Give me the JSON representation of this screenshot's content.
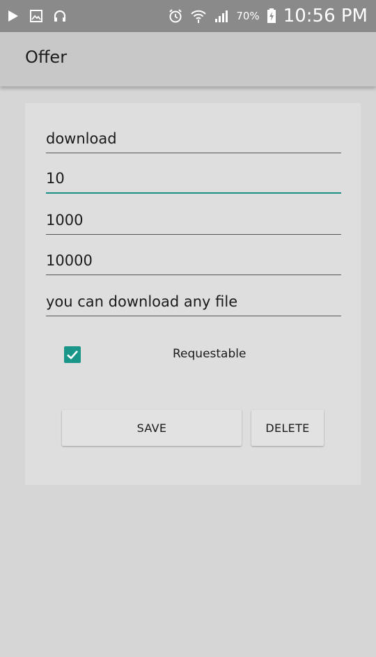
{
  "status_bar": {
    "battery_percent": "70%",
    "time": "10:56 PM",
    "left_icons": [
      "play-icon",
      "image-icon",
      "headset-icon"
    ],
    "right_icons": [
      "alarm-icon",
      "wifi-icon",
      "signal-icon",
      "battery-charging-icon"
    ]
  },
  "app_bar": {
    "title": "Offer"
  },
  "form": {
    "fields": [
      {
        "value": "download",
        "focused": false
      },
      {
        "value": "10",
        "focused": true
      },
      {
        "value": "1000",
        "focused": false
      },
      {
        "value": "10000",
        "focused": false
      },
      {
        "value": "you can download any file",
        "focused": false
      }
    ],
    "requestable": {
      "label": "Requestable",
      "checked": true
    },
    "save_label": "SAVE",
    "delete_label": "DELETE"
  },
  "colors": {
    "accent": "#1a9688",
    "status_bar": "#8a8a8a",
    "app_bar": "#c8c8c8",
    "background": "#d6d6d6",
    "card": "#dedede"
  }
}
